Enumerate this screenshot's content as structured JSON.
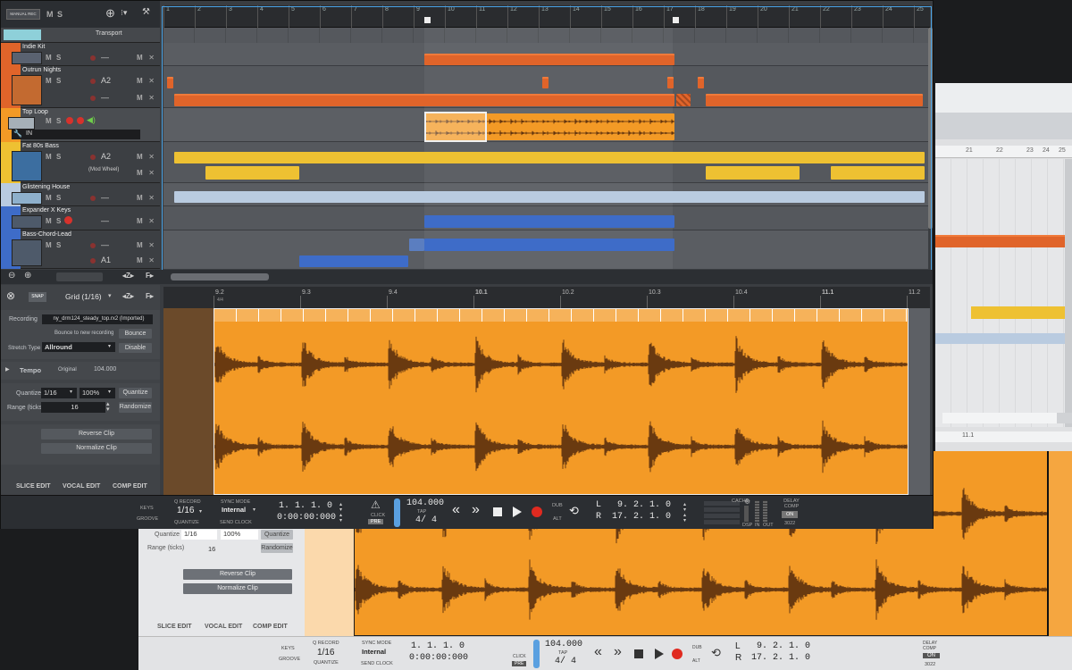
{
  "top_bar": {
    "manual_rec": "MANUAL REC",
    "m": "M",
    "s": "S"
  },
  "ruler_bars": [
    "1",
    "2",
    "3",
    "4",
    "5",
    "6",
    "7",
    "8",
    "9",
    "10",
    "11",
    "12",
    "13",
    "14",
    "15",
    "16",
    "17",
    "18",
    "19",
    "20",
    "21",
    "22",
    "23",
    "24",
    "25"
  ],
  "tracks": [
    {
      "name": "Transport",
      "type": "folder"
    },
    {
      "name": "Indie Kit",
      "sub": "—"
    },
    {
      "name": "Outrun Nights",
      "sub": "A2",
      "sub2": "—"
    },
    {
      "name": "Top Loop",
      "input": "IN"
    },
    {
      "name": "Fat 80s Bass",
      "sub": "A2",
      "sub2": "(Mod Wheel)"
    },
    {
      "name": "Glistening House",
      "sub": "—"
    },
    {
      "name": "Expander X Keys",
      "sub": "—"
    },
    {
      "name": "Bass-Chord-Lead",
      "sub": "—",
      "sub2": "A1"
    }
  ],
  "track_ms": {
    "m": "M",
    "s": "S",
    "x": "✕"
  },
  "editor": {
    "snap": "SNAP",
    "grid": "Grid (1/16)",
    "recording_label": "Recording",
    "recording_file": "ny_drm124_steady_top.rx2 (Imported)",
    "bounce_label": "Bounce to new recording",
    "bounce_btn": "Bounce",
    "stretch_label": "Stretch Type",
    "stretch_value": "Allround",
    "disable_btn": "Disable",
    "tempo_label": "Tempo",
    "original_label": "Original",
    "tempo_value": "104.000",
    "quantize_label": "Quantize",
    "quantize_value": "1/16",
    "quantize_pct": "100%",
    "quantize_btn": "Quantize",
    "range_label": "Range (ticks)",
    "range_value": "16",
    "randomize_btn": "Randomize",
    "reverse_btn": "Reverse Clip",
    "normalize_btn": "Normalize Clip",
    "tab_slice": "SLICE EDIT",
    "tab_vocal": "VOCAL EDIT",
    "tab_comp": "COMP EDIT",
    "ruler": [
      "9.2",
      "9.3",
      "9.4",
      "10.1",
      "10.2",
      "10.3",
      "10.4",
      "11.1",
      "11.2"
    ],
    "ruler_sub": "4/4"
  },
  "transport": {
    "keys": "KEYS",
    "groove": "GROOVE",
    "q_record": "Q RECORD",
    "q_value": "1/16",
    "quantize": "QUANTIZE",
    "sync_mode": "SYNC MODE",
    "sync_value": "Internal",
    "send_clock": "SEND CLOCK",
    "position": "1. 1. 1.   0",
    "time": "0:00:00:000",
    "click": "CLICK",
    "pre": "PRE",
    "tempo": "104.000",
    "tap": "TAP",
    "signature": "4/ 4",
    "dub": "DUB",
    "alt": "ALT",
    "l_label": "L",
    "l_value": "9. 2. 1.   0",
    "r_label": "R",
    "r_value": "17. 2. 1.   0",
    "cache": "CACHE",
    "dsp": "DSP",
    "in": "IN",
    "out": "OUT",
    "delay_comp": "DELAY COMP",
    "on": "ON",
    "num": "3022"
  },
  "bg_window": {
    "quantize_label": "Quantize",
    "quantize_value": "1/16",
    "quantize_pct": "100%",
    "quantize_btn": "Quantize",
    "range_label": "Range (ticks)",
    "range_value": "16",
    "randomize_btn": "Randomize",
    "reverse_btn": "Reverse Clip",
    "normalize_btn": "Normalize Clip",
    "tab_slice": "SLICE EDIT",
    "tab_vocal": "VOCAL EDIT",
    "tab_comp": "COMP EDIT",
    "ruler": [
      "21",
      "22",
      "23",
      "24",
      "25"
    ],
    "ruler2": "11.1",
    "keys": "KEYS",
    "groove": "GROOVE",
    "q_record": "Q RECORD",
    "q_value": "1/16",
    "quantize": "QUANTIZE",
    "sync_mode": "SYNC MODE",
    "sync_value": "Internal",
    "send_clock": "SEND CLOCK",
    "position": "1. 1. 1.   0",
    "time": "0:00:00:000",
    "click": "CLICK",
    "pre": "PRE",
    "tempo": "104.000",
    "tap": "TAP",
    "signature": "4/ 4",
    "dub": "DUB",
    "alt": "ALT",
    "l_label": "L",
    "l_value": "9. 2. 1.   0",
    "r_label": "R",
    "r_value": "17. 2. 1.   0",
    "delay_comp": "DELAY COMP",
    "on": "ON",
    "num": "3022"
  },
  "colors": {
    "audio_orange": "#f39a26",
    "clip_orange": "#e0642a",
    "clip_yellow": "#eec132",
    "clip_light_blue": "#b9cbe0",
    "clip_blue": "#3e6cc8",
    "selection": "#4aa3e6"
  }
}
